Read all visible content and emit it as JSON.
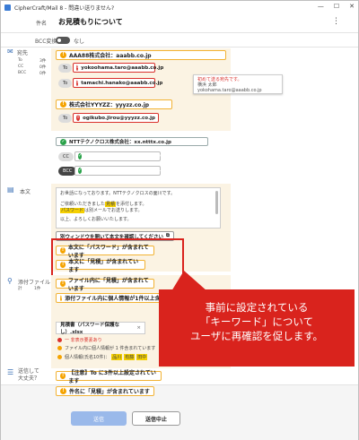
{
  "titlebar": {
    "title": "CipherCraft/Mail 8 - 問違い送りません?"
  },
  "subject": {
    "label": "件名",
    "value": "お見積もりについて"
  },
  "bcc": {
    "label": "BCC変換",
    "toggle_text": "なし"
  },
  "to_section": {
    "label": "宛先",
    "side_labels": {
      "to": "To",
      "cc": "CC",
      "bcc": "BCC",
      "to_count": "3件",
      "cc_count": "0件",
      "bcc_count": "0件"
    },
    "company1": "AAA88株式会社：aaabb.co.jp",
    "addr1_kind": "To",
    "addr1": "yokoohama.taro@aaabb.co.jp",
    "addr2_kind": "To",
    "addr2": "tamachi.hanako@aaabb.co.jp",
    "tooltip_line1": "初めて送る宛先です。",
    "tooltip_line2": "横浜 太郎",
    "tooltip_line3": "yokohama.taro@aaabb.co.jp",
    "company2": "株式会社YYYZZ：yyyzz.co.jp",
    "addr3_kind": "To",
    "addr3": "ogikubo.jirou@yyyzz.co.jp",
    "company3": "NTTテクノクロス株式会社：xx.ntttx.co.jp",
    "addr4_kind": "CC",
    "addr4": "techno.saburou@xx.ntttx.co.jp",
    "addr5_kind": "BCC",
    "addr5": "ciphercraft_ml@xx.ntttx.co.jp"
  },
  "body_section": {
    "label": "本文",
    "line1": "お世話になっております。NTTテクノクロスの面川です。",
    "line2a": "ご依頼いただきました",
    "line2hl": "見積",
    "line2b": "を添付します。",
    "line3hl": "パスワード",
    "line3b": "は別メールでお送りします。",
    "line4": "以上、よろしくお願いいたします。",
    "confirm_button": "別ウィンドウを開いて本文を確認してください",
    "warn1": "本文に「パスワード」が含まれています",
    "warn2": "本文に「見積」が含まれています"
  },
  "attach_section": {
    "label": "添付ファイル",
    "count": "計",
    "count_val": "1件",
    "warn1": "ファイル内に「見積」が含まれています",
    "warn2": "添付ファイル内に個人情報が1件以上含まれています",
    "file_name": "見積書（パスワード保護なし）.xlsx",
    "file_close": "×",
    "line1": "一 非表示要素あり",
    "line2": "ファイル内に個人情報が 1 件含まれています",
    "line3a": "個人情報(氏名10件)：",
    "line3tag1": "品川",
    "line3tag2": "有藤",
    "line3tag3": "田中"
  },
  "check_section": {
    "label": "送信して\n大丈夫？",
    "warn1": "【注意】To に3件以上設定されています",
    "warn2": "件名に「見積」が含まれています"
  },
  "footer": {
    "send": "送信",
    "cancel": "送信中止"
  },
  "callout": {
    "line1": "事前に設定されている",
    "line2": "「キーワード」について",
    "line3": "ユーザに再確認を促します。"
  }
}
